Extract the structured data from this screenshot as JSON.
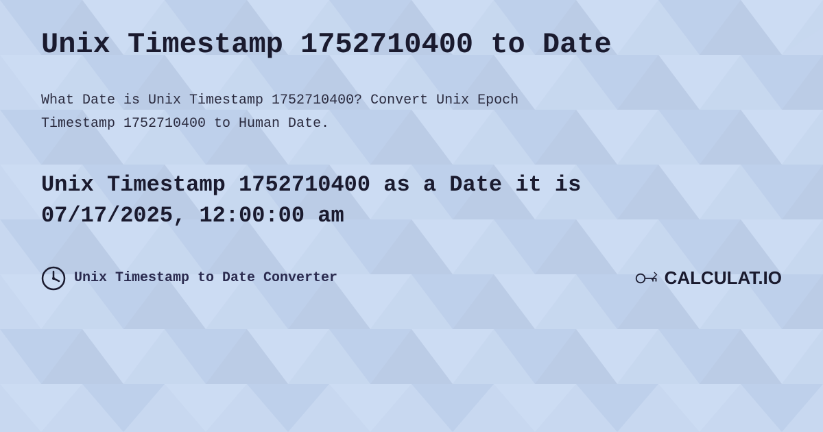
{
  "page": {
    "title": "Unix Timestamp 1752710400 to Date",
    "description_line1": "What Date is Unix Timestamp 1752710400? Convert Unix Epoch",
    "description_line2": "Timestamp 1752710400 to Human Date.",
    "result_line1": "Unix Timestamp 1752710400 as a Date it is",
    "result_line2": "07/17/2025, 12:00:00 am",
    "footer_label": "Unix Timestamp to Date Converter",
    "logo_text": "CALCULAT.IO",
    "bg_color": "#c8d8f0",
    "accent_color": "#1a1a2e"
  }
}
